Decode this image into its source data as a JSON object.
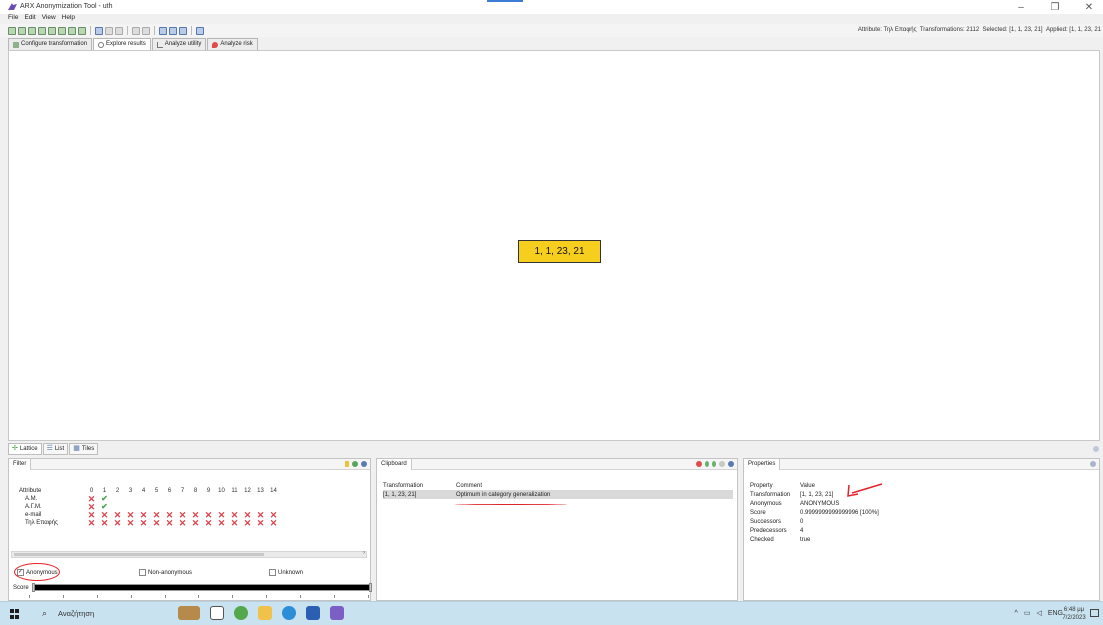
{
  "window": {
    "title": "ARX Anonymization Tool - uth",
    "controls": {
      "minimize": "–",
      "maximize": "❐",
      "close": "✕"
    }
  },
  "menu": [
    "File",
    "Edit",
    "View",
    "Help"
  ],
  "status": {
    "attribute_label": "Attribute:",
    "attribute_value": "Τηλ Επαφής",
    "transformations_label": "Transformations:",
    "transformations_value": "2112",
    "selected_label": "Selected:",
    "selected_value": "[1, 1, 23, 21]",
    "applied_label": "Applied:",
    "applied_value": "[1, 1, 23, 21"
  },
  "perspective_tabs": [
    {
      "label": "Configure transformation",
      "icon": "config-icon"
    },
    {
      "label": "Explore results",
      "icon": "explore-icon"
    },
    {
      "label": "Analyze utility",
      "icon": "utility-icon"
    },
    {
      "label": "Analyze risk",
      "icon": "risk-icon"
    }
  ],
  "lattice_node": {
    "label": "1, 1, 23, 21",
    "color": "#f6cf1e"
  },
  "view_tabs": [
    {
      "label": "Lattice",
      "icon": "lattice-icon"
    },
    {
      "label": "List",
      "icon": "list-icon"
    },
    {
      "label": "Tiles",
      "icon": "tiles-icon"
    }
  ],
  "filter": {
    "tab_label": "Filter",
    "header_attribute": "Attribute",
    "levels": [
      "0",
      "1",
      "2",
      "3",
      "4",
      "5",
      "6",
      "7",
      "8",
      "9",
      "10",
      "11",
      "12",
      "13",
      "14"
    ],
    "rows": [
      {
        "name": "A.M.",
        "marks": [
          "x",
          "check"
        ]
      },
      {
        "name": "A.Γ.Μ.",
        "marks": [
          "x",
          "check"
        ]
      },
      {
        "name": "e-mail",
        "marks": [
          "x",
          "x",
          "x",
          "x",
          "x",
          "x",
          "x",
          "x",
          "x",
          "x",
          "x",
          "x",
          "x",
          "x",
          "x"
        ]
      },
      {
        "name": "Τηλ Επαφής",
        "marks": [
          "x",
          "x",
          "x",
          "x",
          "x",
          "x",
          "x",
          "x",
          "x",
          "x",
          "x",
          "x",
          "x",
          "x",
          "x"
        ]
      }
    ],
    "anonymous_label": "Anonymous",
    "anonymous_checked": true,
    "non_anonymous_label": "Non-anonymous",
    "non_anonymous_checked": false,
    "unknown_label": "Unknown",
    "unknown_checked": false,
    "score_label": "Score"
  },
  "clipboard": {
    "tab_label": "Clipboard",
    "col_transformation": "Transformation",
    "col_comment": "Comment",
    "rows": [
      {
        "transformation": "[1, 1, 23, 21]",
        "comment": "Optimum in category generalization"
      }
    ]
  },
  "properties": {
    "tab_label": "Properties",
    "col_property": "Property",
    "col_value": "Value",
    "rows": [
      {
        "k": "Transformation",
        "v": "[1, 1, 23, 21]"
      },
      {
        "k": "Anonymous",
        "v": "ANONYMOUS"
      },
      {
        "k": "Score",
        "v": "0.9999999999999996 [100%]"
      },
      {
        "k": "Successors",
        "v": "0"
      },
      {
        "k": "Predecessors",
        "v": "4"
      },
      {
        "k": "Checked",
        "v": "true"
      }
    ]
  },
  "taskbar": {
    "search_placeholder": "Αναζήτηση",
    "lang": "ENG",
    "time": "6:48 μμ",
    "date": "7/2/2023"
  },
  "colors": {
    "accent": "#3b7bd4",
    "node": "#f6cf1e",
    "x_mark": "#e0404a",
    "check_mark": "#4aa84a",
    "annotation": "#e0232a",
    "taskbar": "#c9e2ef"
  }
}
